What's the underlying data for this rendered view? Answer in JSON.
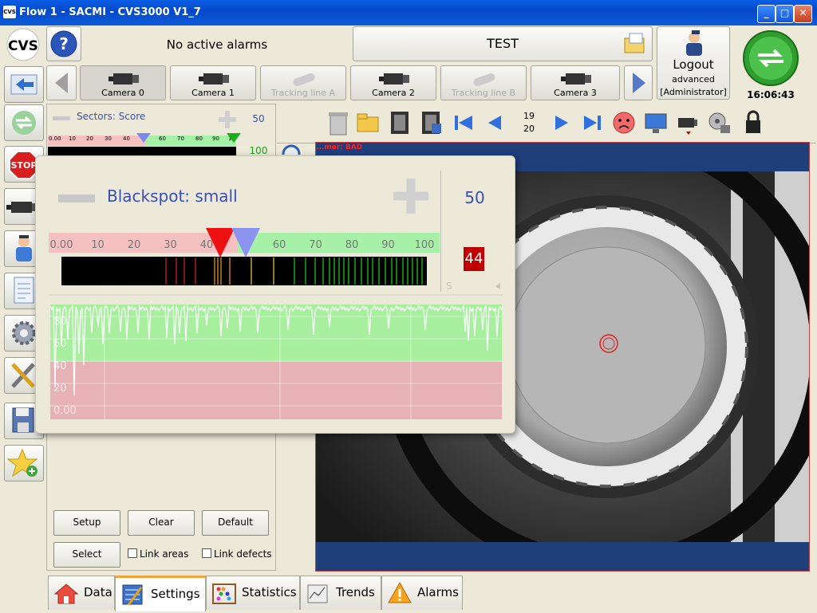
{
  "window": {
    "title": "Flow 1 - SACMI - CVS3000 V1_7",
    "app_icon": "CVS"
  },
  "header": {
    "alarm_status": "No active alarms",
    "recipe_name": "TEST",
    "logout_label": "Logout",
    "user_level": "advanced",
    "user_name": "[Administrator]",
    "clock": "16:06:43",
    "logo": "CVS"
  },
  "cameras": [
    {
      "label": "Camera 0",
      "enabled": true
    },
    {
      "label": "Camera 1",
      "enabled": true
    },
    {
      "label": "Tracking line A",
      "enabled": false
    },
    {
      "label": "Camera 2",
      "enabled": true
    },
    {
      "label": "Tracking line B",
      "enabled": false
    },
    {
      "label": "Camera 3",
      "enabled": true
    }
  ],
  "sectors": {
    "label": "Sectors: Score",
    "top_value": "50",
    "second_value": "100",
    "scale": [
      "0.00",
      "10",
      "20",
      "30",
      "40",
      "",
      "60",
      "70",
      "80",
      "90",
      "1"
    ]
  },
  "toolbar": {
    "frame_current": "19",
    "frame_total": "20"
  },
  "image": {
    "overlay_text": "...mer: BAD"
  },
  "popup": {
    "title": "Blackspot: small",
    "threshold": "50",
    "current_value": "44",
    "side_letter": "S",
    "scale": [
      "0.00",
      "10",
      "20",
      "30",
      "40",
      "50",
      "60",
      "70",
      "80",
      "90",
      "100"
    ],
    "graph_labels": [
      "80",
      "60",
      "40",
      "20",
      "0.00"
    ],
    "colors": {
      "good": "#9ef09e",
      "bad": "#f2b8b8",
      "title": "#3a4fb5",
      "value_box": "#c00000"
    }
  },
  "bottom_buttons": {
    "setup": "Setup",
    "clear": "Clear",
    "default": "Default",
    "select": "Select",
    "link_areas": "Link areas",
    "link_defects": "Link defects"
  },
  "tabs": [
    {
      "label": "Data",
      "active": false,
      "icon": "home-icon"
    },
    {
      "label": "Settings",
      "active": true,
      "icon": "settings-icon"
    },
    {
      "label": "Statistics",
      "active": false,
      "icon": "abacus-icon"
    },
    {
      "label": "Trends",
      "active": false,
      "icon": "trend-icon"
    },
    {
      "label": "Alarms",
      "active": false,
      "icon": "warning-icon"
    }
  ]
}
